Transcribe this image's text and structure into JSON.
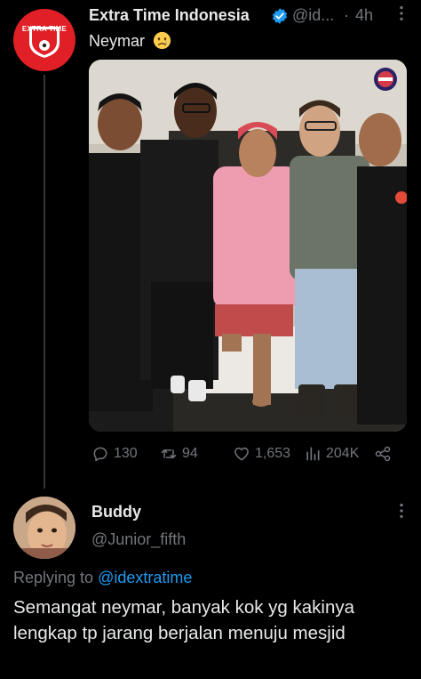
{
  "tweet": {
    "author_name": "Extra Time Indonesia",
    "avatar_text": "EXTRA TIME",
    "handle": "@id...",
    "separator": "·",
    "time": "4h",
    "text": "Neymar",
    "emoji": "sad-face-emoji",
    "stats": {
      "replies": "130",
      "retweets": "94",
      "likes": "1,653",
      "views": "204K"
    }
  },
  "reply": {
    "author_name": "Buddy",
    "handle": "@Junior_fifth",
    "replying_prefix": "Replying to",
    "replying_to": "@idextratime",
    "text": "Semangat neymar, banyak kok yg kakinya lengkap tp jarang berjalan menuju mesjid"
  },
  "colors": {
    "background": "#000000",
    "text": "#e7e9ea",
    "muted": "#71767b",
    "link": "#1d9bf0",
    "verified": "#1d9bf0",
    "brand_red": "#e01f26"
  },
  "icons": [
    "verified-badge-icon",
    "more-icon",
    "reply-icon",
    "retweet-icon",
    "like-icon",
    "views-icon",
    "share-icon"
  ]
}
